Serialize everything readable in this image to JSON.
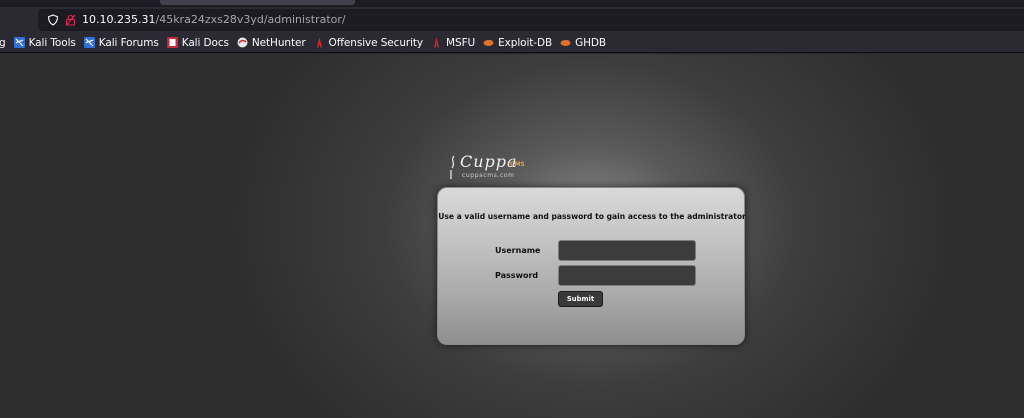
{
  "browser": {
    "url_host": "10.10.235.31",
    "url_path": "/45kra24zxs28v3yd/administrator/",
    "bookmarks": [
      {
        "label": "g",
        "icon": "partial-bookmark-icon"
      },
      {
        "label": "Kali Tools",
        "icon": "kali-icon"
      },
      {
        "label": "Kali Forums",
        "icon": "kali-icon"
      },
      {
        "label": "Kali Docs",
        "icon": "kali-docs-icon"
      },
      {
        "label": "NetHunter",
        "icon": "nethunter-icon"
      },
      {
        "label": "Offensive Security",
        "icon": "offsec-icon"
      },
      {
        "label": "MSFU",
        "icon": "msfu-icon"
      },
      {
        "label": "Exploit-DB",
        "icon": "exploitdb-icon"
      },
      {
        "label": "GHDB",
        "icon": "ghdb-icon"
      }
    ]
  },
  "logo": {
    "name": "Cuppa",
    "badge": "CMS",
    "site": "cuppacms.com"
  },
  "login": {
    "message": "Use a valid username and password to gain access to the administrator",
    "username_label": "Username",
    "password_label": "Password",
    "username_value": "",
    "password_value": "",
    "submit_label": "Submit"
  },
  "colors": {
    "browser_bg": "#2b2a33",
    "urlbar_bg": "#1c1b22",
    "kali_blue": "#2f6fd6",
    "offsec_red": "#d42c2c",
    "exploitdb_orange": "#e0702a",
    "cms_badge": "#e8a14a"
  }
}
